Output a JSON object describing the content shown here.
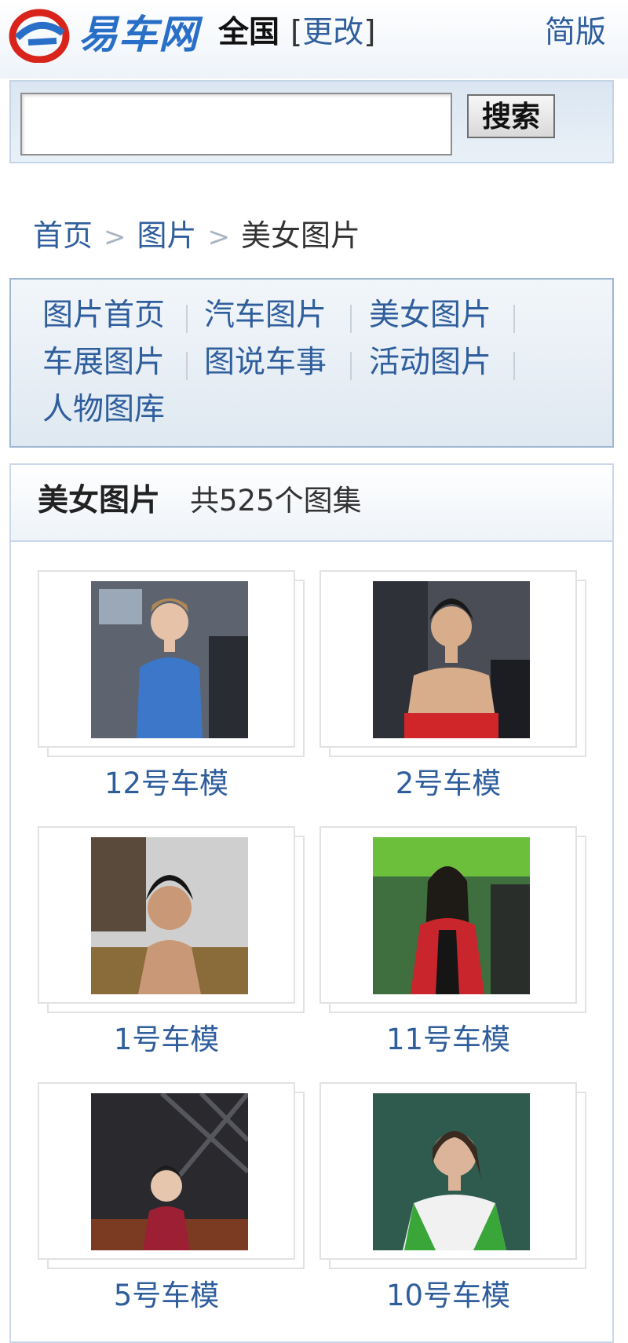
{
  "header": {
    "logo_text": "易车网",
    "region": "全国",
    "change_open": "[",
    "change_label": "更改",
    "change_close": "]",
    "lite_label": "简版"
  },
  "search": {
    "placeholder": "",
    "button_label": "搜索"
  },
  "breadcrumb": {
    "items": [
      "首页",
      "图片"
    ],
    "separator": ">",
    "current": "美女图片"
  },
  "nav": {
    "items": [
      "图片首页",
      "汽车图片",
      "美女图片",
      "车展图片",
      "图说车事",
      "活动图片",
      "人物图库"
    ]
  },
  "panel": {
    "title": "美女图片",
    "count_text": "共525个图集"
  },
  "gallery": {
    "items": [
      {
        "caption": "12号车模"
      },
      {
        "caption": "2号车模"
      },
      {
        "caption": "1号车模"
      },
      {
        "caption": "11号车模"
      },
      {
        "caption": "5号车模"
      },
      {
        "caption": "10号车模"
      }
    ]
  },
  "colors": {
    "link": "#2f5e9d",
    "brand_red": "#d9241b",
    "brand_blue": "#2a6fc7"
  }
}
